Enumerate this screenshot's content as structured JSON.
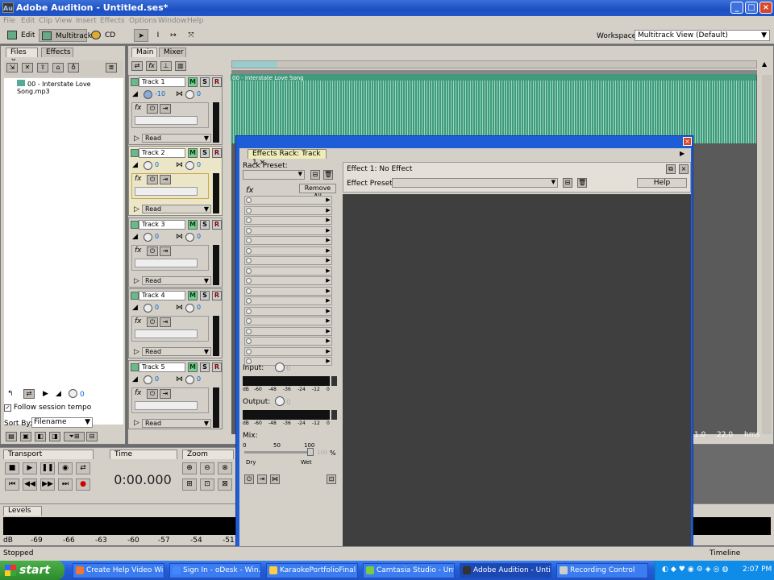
{
  "app": {
    "title": "Adobe Audition - Untitled.ses*",
    "logo": "Au"
  },
  "menu": [
    "File",
    "Edit",
    "Clip",
    "View",
    "Insert",
    "Effects",
    "Options",
    "Window",
    "Help"
  ],
  "toolbar": {
    "edit": "Edit",
    "multitrack": "Multitrack",
    "cd": "CD",
    "workspace_label": "Workspace:",
    "workspace_value": "Multitrack View (Default)"
  },
  "files": {
    "tabs": [
      "Files",
      "Effects"
    ],
    "item": "00 - Interstate Love Song.mp3",
    "follow": "Follow session tempo",
    "sortby_label": "Sort By:",
    "sortby_value": "Filename",
    "vol": "0"
  },
  "main": {
    "tabs": [
      "Main",
      "Mixer"
    ],
    "clip_label": "00 - Interstate Love Song"
  },
  "tracks": [
    {
      "name": "Track 1",
      "vol": "-10",
      "pan": "0",
      "mode": "Read"
    },
    {
      "name": "Track 2",
      "vol": "0",
      "pan": "0",
      "mode": "Read"
    },
    {
      "name": "Track 3",
      "vol": "0",
      "pan": "0",
      "mode": "Read"
    },
    {
      "name": "Track 4",
      "vol": "0",
      "pan": "0",
      "mode": "Read"
    },
    {
      "name": "Track 5",
      "vol": "0",
      "pan": "0",
      "mode": "Read"
    }
  ],
  "track_buttons": {
    "m": "M",
    "s": "S",
    "r": "R"
  },
  "fxrack": {
    "tab": "Effects Rack: Track 1",
    "rack_preset": "Rack Preset:",
    "remove_all": "Remove All",
    "input": "Input:",
    "output": "Output:",
    "mix": "Mix:",
    "dry": "Dry",
    "wet": "Wet",
    "pct": "%",
    "effect_title": "Effect 1: No Effect",
    "effect_preset": "Effect Preset:",
    "help": "Help",
    "db_scale": [
      "dB",
      "-60",
      "-48",
      "-36",
      "-24",
      "-12",
      "0"
    ],
    "mix_scale": [
      "0",
      "50",
      "100"
    ],
    "mix_value": "100",
    "io_value": "0"
  },
  "timeline": {
    "left": "1.0",
    "right": "22.0",
    "unit": "hms"
  },
  "transport": {
    "label": "Transport",
    "time_label": "Time",
    "time": "0:00.000",
    "zoom_label": "Zoom"
  },
  "levels": {
    "label": "Levels",
    "scale": [
      "dB",
      "-69",
      "-66",
      "-63",
      "-60",
      "-57",
      "-54",
      "-51"
    ]
  },
  "status": {
    "left": "Stopped",
    "right": "Timeline"
  },
  "taskbar": {
    "start": "start",
    "items": [
      "Create Help Video Wi...",
      "Sign In - oDesk - Win...",
      "KaraokePortfolioFinal",
      "Camtasia Studio - Unt...",
      "Adobe Audition - Unti...",
      "Recording Control"
    ],
    "clock": "2:07 PM"
  },
  "colors": {
    "title_blue": "#1c4fc2",
    "wave_green": "#3f9b7c",
    "panel_gray": "#d4d0c8",
    "dark_panel": "#3f3f3f"
  }
}
